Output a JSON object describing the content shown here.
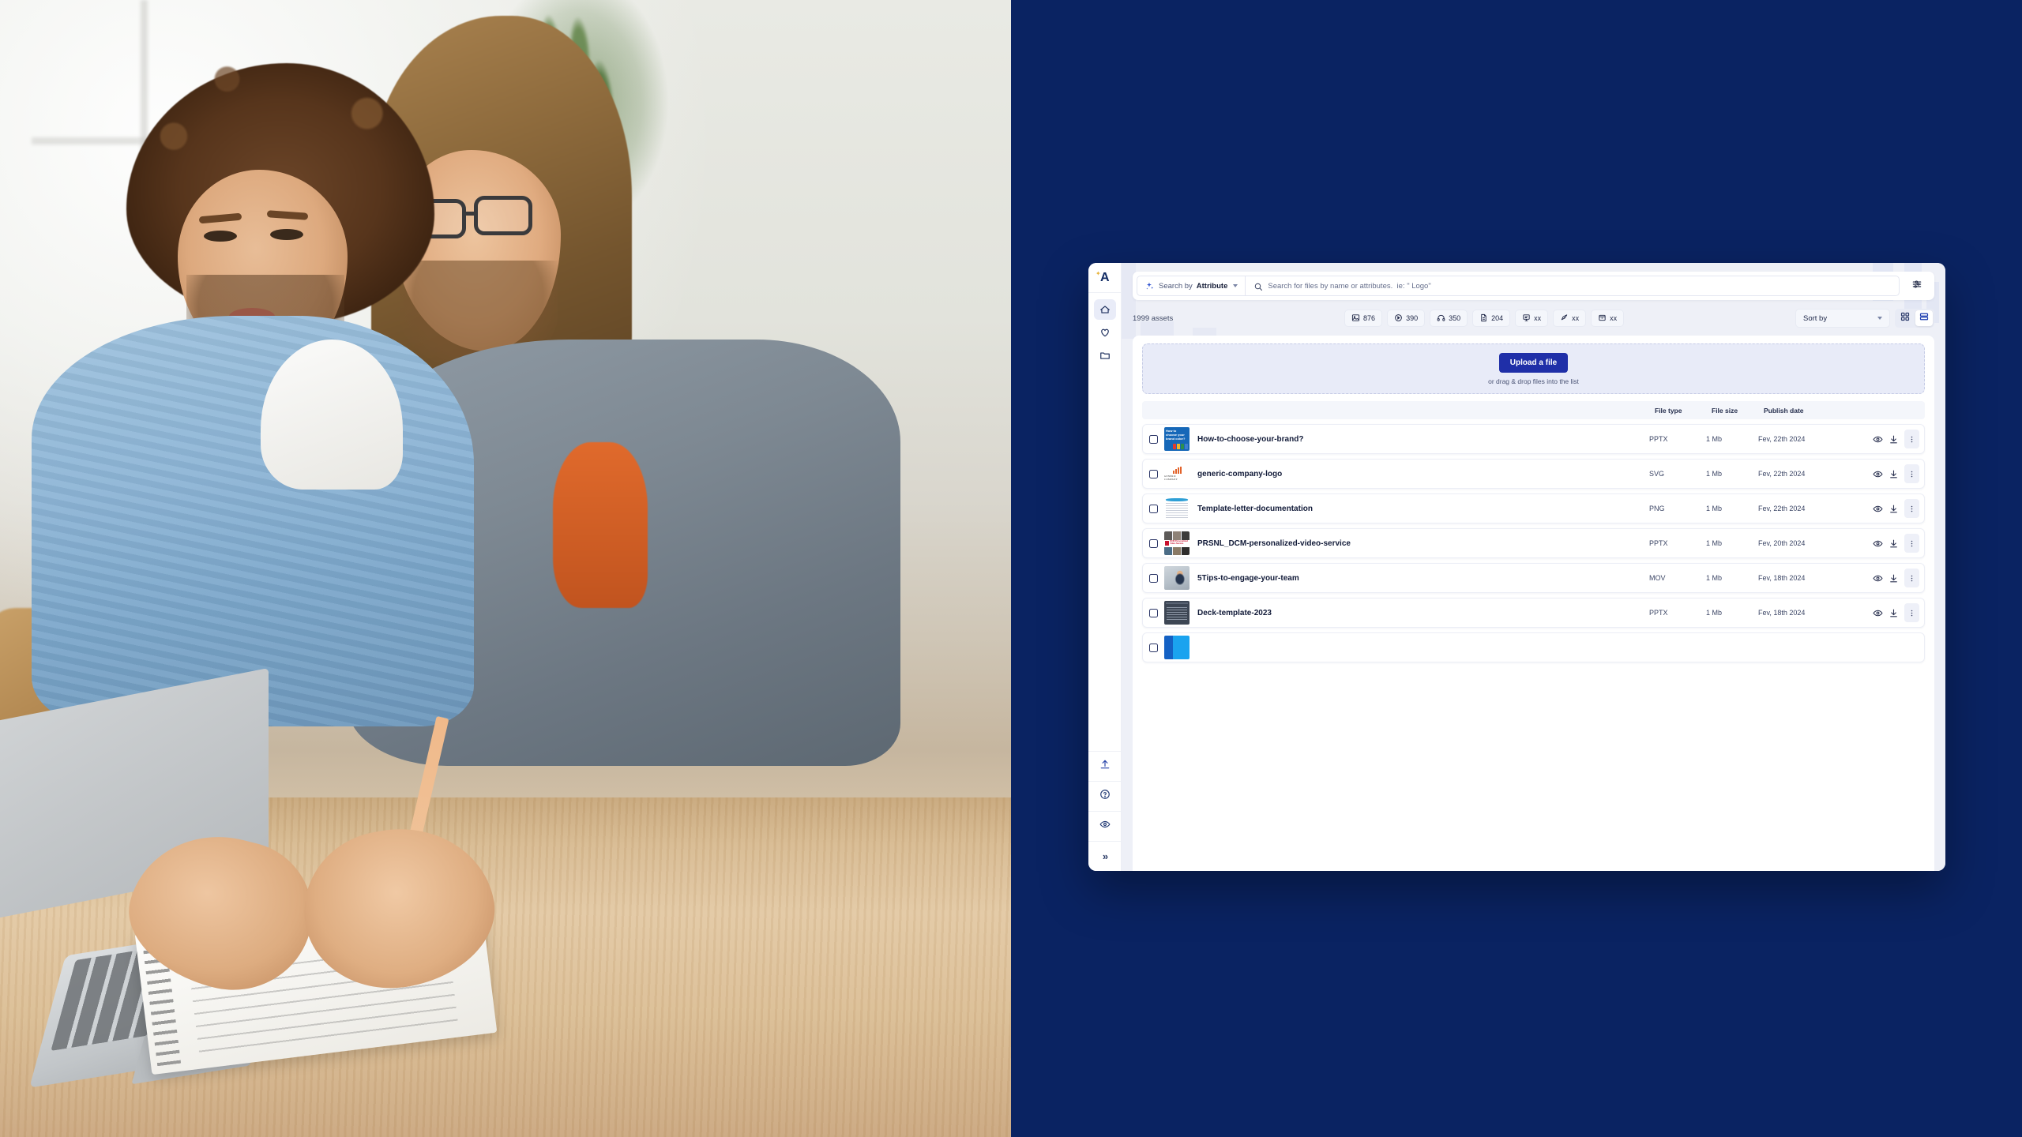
{
  "app": {
    "logo_letter": "A",
    "background_color": "#0a2362",
    "accent_color": "#1f2fa8"
  },
  "sidebar": {
    "top_items": [
      {
        "name": "home",
        "icon": "home-icon",
        "active": true
      },
      {
        "name": "favorites",
        "icon": "heart-icon",
        "active": false
      },
      {
        "name": "folders",
        "icon": "folder-icon",
        "active": false
      }
    ],
    "bottom_items": [
      {
        "name": "upload",
        "icon": "upload-icon"
      },
      {
        "name": "help",
        "icon": "help-circle-icon"
      },
      {
        "name": "account",
        "icon": "eye-icon"
      },
      {
        "name": "expand",
        "icon": "chevron-double-right-icon",
        "glyph": "»"
      }
    ]
  },
  "search": {
    "search_by_label": "Search by",
    "search_by_value": "Attribute",
    "placeholder": "Search for files by name or attributes.  ie: \" Logo\"",
    "value": "",
    "filter_icon": "sliders-icon"
  },
  "toolbar": {
    "assets_count": "1999 assets",
    "chips": [
      {
        "icon": "image-icon",
        "count": "876"
      },
      {
        "icon": "play-circle-icon",
        "count": "390"
      },
      {
        "icon": "headphones-icon",
        "count": "350"
      },
      {
        "icon": "document-icon",
        "count": "204"
      },
      {
        "icon": "presentation-icon",
        "count": "xx"
      },
      {
        "icon": "pen-nib-icon",
        "count": "xx"
      },
      {
        "icon": "archive-icon",
        "count": "xx"
      }
    ],
    "sort_by_label": "Sort by",
    "view_grid": "grid-view-icon",
    "view_list": "list-view-icon",
    "view_active": "list"
  },
  "dropzone": {
    "upload_button": "Upload a file",
    "hint": "or drag & drop files into the list"
  },
  "table": {
    "columns": [
      "",
      "",
      "File type",
      "File size",
      "Publish date",
      ""
    ],
    "headers": {
      "file_type": "File type",
      "file_size": "File size",
      "publish_date": "Publish date"
    },
    "rows": [
      {
        "name": "How-to-choose-your-brand?",
        "type": "PPTX",
        "size": "1 Mb",
        "date": "Fev, 22th 2024",
        "thumb": "brand"
      },
      {
        "name": "generic-company-logo",
        "type": "SVG",
        "size": "1 Mb",
        "date": "Fev, 22th 2024",
        "thumb": "logo"
      },
      {
        "name": "Template-letter-documentation",
        "type": "PNG",
        "size": "1 Mb",
        "date": "Fev, 22th 2024",
        "thumb": "doc"
      },
      {
        "name": "PRSNL_DCM-personalized-video-service",
        "type": "PPTX",
        "size": "1 Mb",
        "date": "Fev, 20th 2024",
        "thumb": "video"
      },
      {
        "name": "5Tips-to-engage-your-team",
        "type": "MOV",
        "size": "1 Mb",
        "date": "Fev, 18th 2024",
        "thumb": "person"
      },
      {
        "name": "Deck-template-2023",
        "type": "PPTX",
        "size": "1 Mb",
        "date": "Fev, 18th 2024",
        "thumb": "deck"
      },
      {
        "name": "",
        "type": "",
        "size": "",
        "date": "",
        "thumb": "blue"
      }
    ],
    "row_actions": {
      "preview": "eye-icon",
      "download": "download-icon",
      "more": "kebab-menu-icon"
    }
  },
  "thumbnail_text": {
    "brand_title": "How to choose your brand color?",
    "logo_name": "GENERIC COMPANY",
    "video_label": "DCM Personalized Video Service",
    "video_brand": "PRSNL"
  }
}
